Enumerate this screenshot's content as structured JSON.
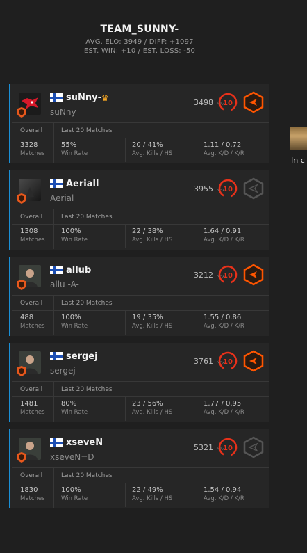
{
  "team": {
    "name": "TEAM_SUNNY-",
    "stats_line1": "AVG. ELO: 3949 / DIFF: +1097",
    "stats_line2": "EST. WIN: +10 / EST. LOSS: -50"
  },
  "labels": {
    "overall": "Overall",
    "last20": "Last 20 Matches",
    "matches": "Matches",
    "win_rate": "Win Rate",
    "kills_hs": "Avg. Kills / HS",
    "kd_kr": "Avg. K/D / K/R"
  },
  "players": [
    {
      "nick": "suNny-",
      "name": "suNny",
      "elo": "3498",
      "level": "10",
      "matches": "3328",
      "win_rate": "55%",
      "kills_hs": "20 / 41%",
      "kd_kr": "1.11 / 0.72",
      "leader": true,
      "rank_active": true,
      "avatar": "mousesports-logo"
    },
    {
      "nick": "Aeriall",
      "name": "Aerial",
      "elo": "3955",
      "level": "10",
      "matches": "1308",
      "win_rate": "100%",
      "kills_hs": "22 / 38%",
      "kd_kr": "1.64 / 0.91",
      "leader": false,
      "rank_active": false,
      "avatar": "default-avatar"
    },
    {
      "nick": "allub",
      "name": "allu -A-",
      "elo": "3212",
      "level": "10",
      "matches": "488",
      "win_rate": "100%",
      "kills_hs": "19 / 35%",
      "kd_kr": "1.55 / 0.86",
      "leader": false,
      "rank_active": true,
      "avatar": "player-photo"
    },
    {
      "nick": "sergej",
      "name": "sergej",
      "elo": "3761",
      "level": "10",
      "matches": "1481",
      "win_rate": "80%",
      "kills_hs": "23 / 56%",
      "kd_kr": "1.77 / 0.95",
      "leader": false,
      "rank_active": true,
      "avatar": "player-photo"
    },
    {
      "nick": "xseveN",
      "name": "xseveN=D",
      "elo": "5321",
      "level": "10",
      "matches": "1830",
      "win_rate": "100%",
      "kills_hs": "22 / 49%",
      "kd_kr": "1.54 / 0.94",
      "leader": false,
      "rank_active": false,
      "avatar": "player-photo"
    }
  ],
  "side": {
    "label": "In c"
  },
  "colors": {
    "accent": "#ff5500",
    "level_red": "#e8311a",
    "rank_orange": "#ff5500",
    "player_border": "#1a8fd6"
  }
}
